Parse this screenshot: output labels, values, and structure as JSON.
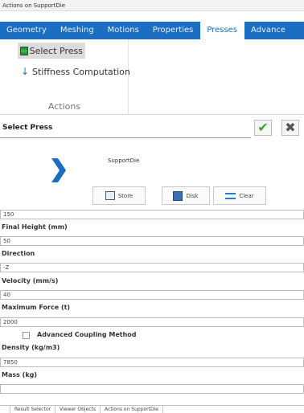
{
  "window": {
    "title": "Actions on SupportDie"
  },
  "tabs": [
    {
      "label": "Geometry",
      "active": false
    },
    {
      "label": "Meshing",
      "active": false
    },
    {
      "label": "Motions",
      "active": false
    },
    {
      "label": "Properties",
      "active": false
    },
    {
      "label": "Presses",
      "active": true
    },
    {
      "label": "Advance",
      "active": false
    }
  ],
  "ribbon": {
    "items": [
      {
        "label": "Select Press",
        "icon": "press-icon",
        "active": true
      },
      {
        "label": "Stiffness Computation",
        "icon": "down-arrow-icon",
        "active": false
      }
    ],
    "group_label": "Actions"
  },
  "panel": {
    "title": "Select Press",
    "ok_icon": "checkmark-icon",
    "cancel_icon": "close-icon",
    "press_name": "SupportDie",
    "buttons": {
      "store": "Store",
      "disk": "Disk",
      "clear": "Clear"
    }
  },
  "form": {
    "first_value": "150",
    "fields": [
      {
        "label": "Final Height (mm)",
        "value": "50"
      },
      {
        "label": "Direction",
        "value": "-Z"
      },
      {
        "label": "Velocity (mm/s)",
        "value": "40"
      },
      {
        "label": "Maximum Force (t)",
        "value": "2000"
      }
    ],
    "advanced_coupling": {
      "label": "Advanced Coupling Method",
      "checked": false
    },
    "fields2": [
      {
        "label": "Density (kg/m3)",
        "value": "7850"
      },
      {
        "label": "Mass (kg)",
        "value": ""
      }
    ]
  },
  "bottom_tabs": [
    {
      "label": "Result Selector",
      "active": false
    },
    {
      "label": "Viewer Objects",
      "active": false
    },
    {
      "label": "Actions on SupportDie",
      "active": true
    }
  ],
  "colors": {
    "accent": "#1b6ec2",
    "ok": "#3aa33a"
  }
}
